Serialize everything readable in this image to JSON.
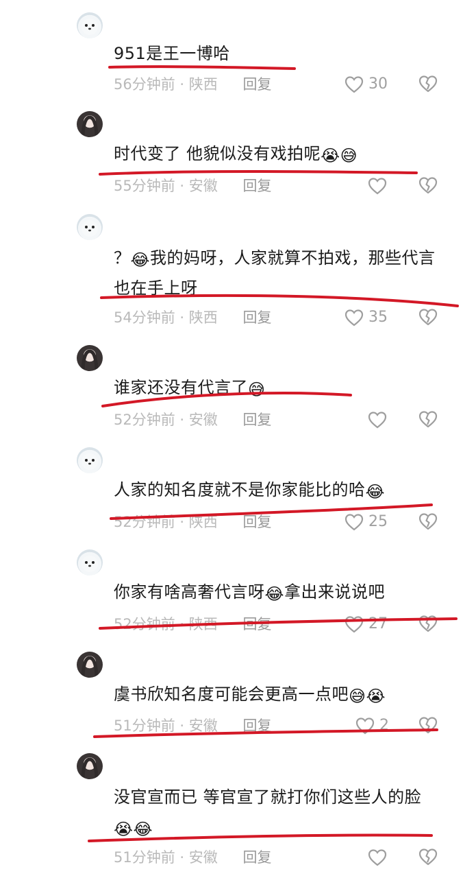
{
  "comments": [
    {
      "avatar": "seal",
      "text": "951是王一博哈",
      "emojis": "",
      "time": "56分钟前",
      "location": "陕西",
      "reply": "回复",
      "likes": "30"
    },
    {
      "avatar": "girl",
      "text": "时代变了 他貌似没有戏拍呢",
      "emojis": "😭😅",
      "time": "55分钟前",
      "location": "安徽",
      "reply": "回复",
      "likes": ""
    },
    {
      "avatar": "seal",
      "text_prefix": "？",
      "emojis": "😂",
      "text": "我的妈呀，人家就算不拍戏，那些代言也在手上呀",
      "time": "54分钟前",
      "location": "陕西",
      "reply": "回复",
      "likes": "35"
    },
    {
      "avatar": "girl",
      "text": "谁家还没有代言了",
      "emojis": "😅",
      "time": "52分钟前",
      "location": "安徽",
      "reply": "回复",
      "likes": ""
    },
    {
      "avatar": "seal",
      "text": "人家的知名度就不是你家能比的哈",
      "emojis": "😂",
      "time": "52分钟前",
      "location": "陕西",
      "reply": "回复",
      "likes": "25"
    },
    {
      "avatar": "seal",
      "text_a": "你家有啥高奢代言呀",
      "emojis": "😂",
      "text_b": "拿出来说说吧",
      "time": "52分钟前",
      "location": "陕西",
      "reply": "回复",
      "likes": "27"
    },
    {
      "avatar": "girl",
      "text": "虞书欣知名度可能会更高一点吧",
      "emojis": "😅😭",
      "time": "51分钟前",
      "location": "安徽",
      "reply": "回复",
      "likes": "2"
    },
    {
      "avatar": "girl",
      "text": "没官宣而已  等官宣了就打你们这些人的脸",
      "emojis": "😭😂",
      "time": "51分钟前",
      "location": "安徽",
      "reply": "回复",
      "likes": ""
    }
  ],
  "icons": {
    "like": "heart-outline-icon",
    "dislike": "broken-heart-icon"
  },
  "colors": {
    "annotation": "#d31826",
    "meta": "#b9b9b9",
    "text": "#1b1b1b",
    "icon": "#9e9e9e"
  }
}
